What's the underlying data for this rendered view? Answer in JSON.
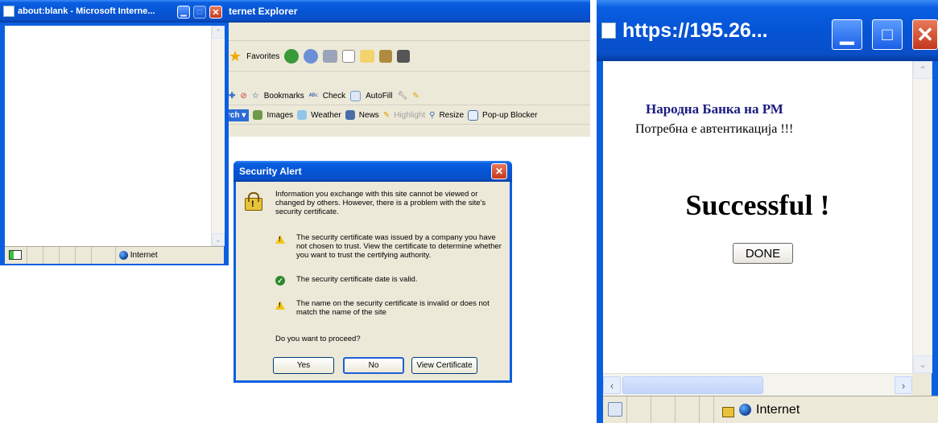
{
  "bg_window": {
    "title": "ternet Explorer",
    "toolbar1": {
      "favorites": "Favorites"
    },
    "toolbar2": {
      "bookmarks": "Bookmarks",
      "check": "Check",
      "autofill": "AutoFill"
    },
    "toolbar3": {
      "search": "rch",
      "images": "Images",
      "weather": "Weather",
      "news": "News",
      "highlight": "Highlight",
      "resize": "Resize",
      "popup": "Pop-up Blocker"
    }
  },
  "blank_window": {
    "title": "about:blank - Microsoft Interne...",
    "status_zone": "Internet"
  },
  "security_alert": {
    "title": "Security Alert",
    "intro": "Information you exchange with this site cannot be viewed or changed by others. However, there is a problem with the site's security certificate.",
    "items": [
      {
        "icon": "warning-icon",
        "text": "The security certificate was issued by a company you have not chosen to trust. View the certificate to determine whether you want to trust the certifying authority."
      },
      {
        "icon": "check-icon",
        "text": "The security certificate date is valid."
      },
      {
        "icon": "warning-icon",
        "text": "The name on the security certificate is invalid or does not match the name of the site"
      }
    ],
    "question": "Do you want to proceed?",
    "buttons": {
      "yes": "Yes",
      "no": "No",
      "view": "View Certificate"
    }
  },
  "popup_window": {
    "title": "https://195.26...",
    "bank_name": "Народна Банка на РМ",
    "auth_message": "Потребна е автентикација !!!",
    "headline": "Successful !",
    "done_button": "DONE",
    "status_zone": "Internet"
  },
  "colors": {
    "xp_blue": "#0a5fe0",
    "dialog_bg": "#ece9d8",
    "close_red": "#c3381c",
    "bank_text": "#1a1a80"
  }
}
